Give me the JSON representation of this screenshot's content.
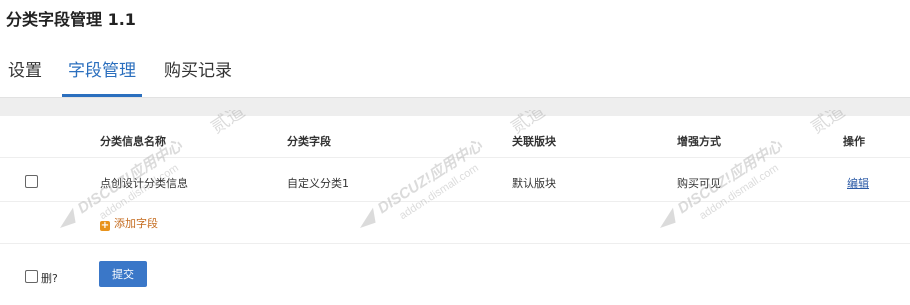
{
  "page": {
    "title": "分类字段管理 1.1"
  },
  "tabs": [
    {
      "label": "设置",
      "active": false
    },
    {
      "label": "字段管理",
      "active": true
    },
    {
      "label": "购买记录",
      "active": false
    }
  ],
  "table": {
    "headers": [
      "分类信息名称",
      "分类字段",
      "关联版块",
      "增强方式",
      "操作"
    ],
    "rows": [
      {
        "name": "点创设计分类信息",
        "field": "自定义分类1",
        "forum": "默认版块",
        "mode": "购买可见",
        "action": "编辑"
      }
    ]
  },
  "add_field_label": "添加字段",
  "delete_label": "删?",
  "submit_label": "提交",
  "watermark": {
    "brand": "DISCUZ!应用中心",
    "url": "addon.dismall.com",
    "mark": "贰道"
  },
  "colors": {
    "accent": "#2b6fbe",
    "button": "#3a77c8",
    "add_link": "#c46a1d"
  }
}
